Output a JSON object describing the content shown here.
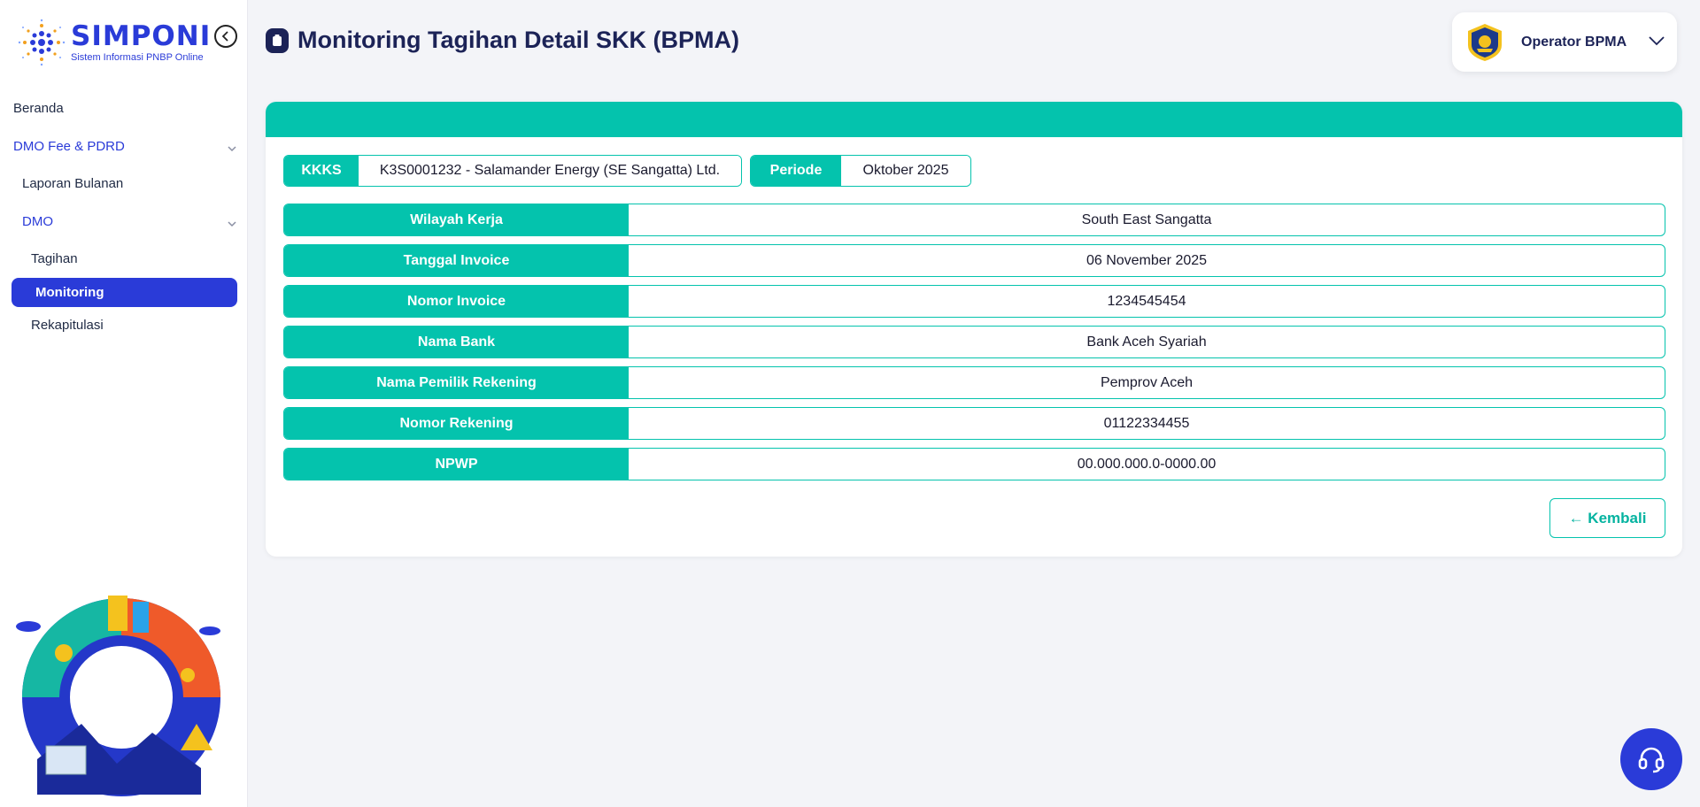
{
  "brand": {
    "name": "SIMPONI",
    "tagline": "Sistem Informasi PNBP Online"
  },
  "sidebar": {
    "items": [
      {
        "label": "Beranda"
      },
      {
        "label": "DMO Fee & PDRD"
      },
      {
        "label": "Laporan Bulanan"
      },
      {
        "label": "DMO"
      },
      {
        "label": "Tagihan"
      },
      {
        "label": "Monitoring"
      },
      {
        "label": "Rekapitulasi"
      }
    ]
  },
  "header": {
    "title": "Monitoring Tagihan Detail SKK (BPMA)",
    "user": "Operator BPMA"
  },
  "filters": {
    "kkks_label": "KKKS",
    "kkks_value": "K3S0001232 - Salamander Energy (SE Sangatta) Ltd.",
    "periode_label": "Periode",
    "periode_value": "Oktober 2025"
  },
  "details": [
    {
      "label": "Wilayah Kerja",
      "value": "South East Sangatta"
    },
    {
      "label": "Tanggal Invoice",
      "value": "06 November 2025"
    },
    {
      "label": "Nomor Invoice",
      "value": "1234545454"
    },
    {
      "label": "Nama Bank",
      "value": "Bank Aceh Syariah"
    },
    {
      "label": "Nama Pemilik Rekening",
      "value": "Pemprov Aceh"
    },
    {
      "label": "Nomor Rekening",
      "value": "01122334455"
    },
    {
      "label": "NPWP",
      "value": "00.000.000.0-0000.00"
    }
  ],
  "actions": {
    "back_label": "← Kembali"
  },
  "colors": {
    "primary": "#2a3bd8",
    "teal": "#04c3ad",
    "navy": "#1c2357"
  },
  "icons": {
    "collapse": "chevron-left-icon",
    "help": "headset-icon",
    "title": "clipboard-icon"
  }
}
